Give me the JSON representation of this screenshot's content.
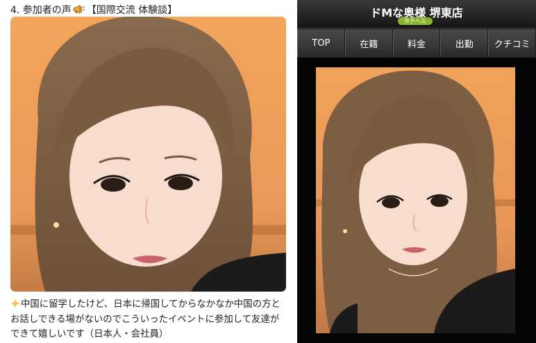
{
  "left": {
    "heading_prefix": "4. 参加者の声",
    "heading_icon": "megaphone-icon",
    "heading_suffix": "【国際交流 体験談】",
    "caption_icon": "sparkle-star-icon",
    "caption": "中国に留学したけど、日本に帰国してからなかなか中国の方とお話しできる場がないのでこういったイベントに参加して友達ができて嬉しいです（日本人・会社員）"
  },
  "right": {
    "shop_name": "ドMな奥様 堺東店",
    "shop_badge": "ホテヘル",
    "nav": [
      {
        "label": "TOP"
      },
      {
        "label": "在籍"
      },
      {
        "label": "料金"
      },
      {
        "label": "出勤"
      },
      {
        "label": "クチコミ"
      }
    ],
    "accent_color": "#8ab42d"
  }
}
